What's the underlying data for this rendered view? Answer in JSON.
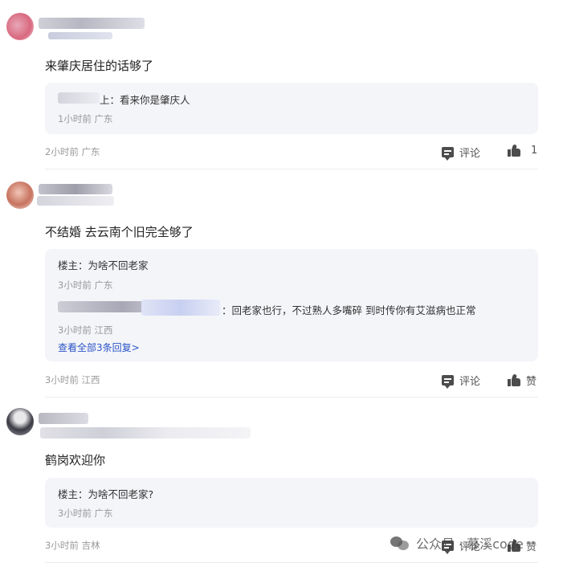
{
  "comments": [
    {
      "content": "来肇庆居住的话够了",
      "replies": [
        {
          "text": "看来你是肇庆人",
          "meta": "1小时前 广东"
        }
      ],
      "meta": "2小时前 广东",
      "comment_label": "评论",
      "like_label": "1"
    },
    {
      "content": "不结婚 去云南个旧完全够了",
      "replies": [
        {
          "text": "楼主：为啥不回老家",
          "meta": "3小时前 广东"
        },
        {
          "text": "：回老家也行，不过熟人多嘴碎 到时传你有艾滋病也正常",
          "meta": "3小时前 江西"
        }
      ],
      "view_all": "查看全部3条回复>",
      "meta": "3小时前 江西",
      "comment_label": "评论",
      "like_label": "赞"
    },
    {
      "content": "鹤岗欢迎你",
      "replies": [
        {
          "text": "楼主：为啥不回老家?",
          "meta": "3小时前 广东"
        }
      ],
      "meta": "3小时前 吉林",
      "comment_label": "评论",
      "like_label": "赞"
    }
  ],
  "first_reply_suffix": "上：",
  "watermark": "公众号 · 慕溪code",
  "colors": {
    "accent_link": "#2b55c7",
    "meta_gray": "#999999",
    "reply_bg": "#f4f5f9",
    "icon": "#4c4c4c"
  }
}
